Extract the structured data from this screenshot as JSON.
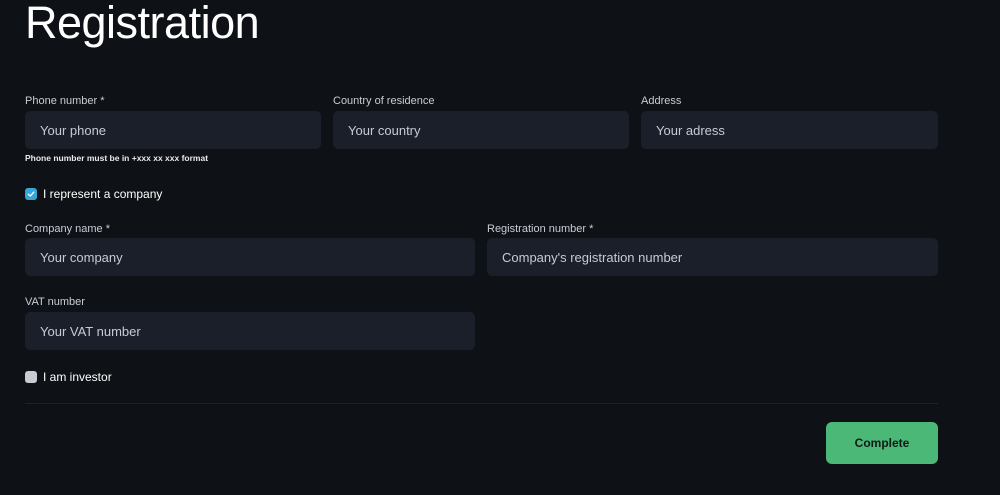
{
  "page": {
    "title": "Registration"
  },
  "phone": {
    "label": "Phone number *",
    "placeholder": "Your phone",
    "hint": "Phone number must be in +xxx xx xxx format"
  },
  "country": {
    "label": "Country of residence",
    "placeholder": "Your country"
  },
  "address": {
    "label": "Address",
    "placeholder": "Your adress"
  },
  "company_checkbox": {
    "label": "I represent a company",
    "checked": true
  },
  "company_name": {
    "label": "Company name *",
    "placeholder": "Your company"
  },
  "registration_number": {
    "label": "Registration number *",
    "placeholder": "Company's registration number"
  },
  "vat": {
    "label": "VAT number",
    "placeholder": "Your VAT number"
  },
  "investor_checkbox": {
    "label": "I am investor",
    "checked": false
  },
  "actions": {
    "complete_label": "Complete"
  },
  "colors": {
    "background": "#0e1116",
    "input_background": "#1a1f2a",
    "checkbox_checked": "#35a6d8",
    "button": "#4cb878"
  }
}
